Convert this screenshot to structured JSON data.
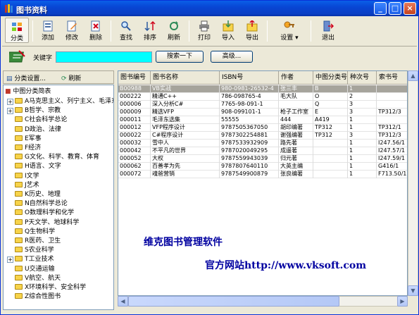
{
  "window": {
    "title": "图书资料"
  },
  "toolbar": {
    "items": [
      {
        "label": "分类",
        "icon": "category-icon"
      },
      {
        "label": "添加",
        "icon": "add-icon"
      },
      {
        "label": "修改",
        "icon": "edit-icon"
      },
      {
        "label": "删除",
        "icon": "delete-icon"
      },
      {
        "label": "查找",
        "icon": "find-icon"
      },
      {
        "label": "排序",
        "icon": "sort-icon"
      },
      {
        "label": "刷新",
        "icon": "refresh-icon"
      },
      {
        "label": "打印",
        "icon": "print-icon"
      },
      {
        "label": "导入",
        "icon": "import-icon"
      },
      {
        "label": "导出",
        "icon": "export-icon"
      },
      {
        "label": "设置",
        "icon": "settings-icon"
      },
      {
        "label": "退出",
        "icon": "exit-icon"
      }
    ]
  },
  "search": {
    "keyword_label": "关键字",
    "keyword_value": "",
    "search_button": "搜索一下",
    "advanced_button": "高级..."
  },
  "left": {
    "category_settings": "分类设置...",
    "refresh": "刷新",
    "root": "中图分类简表",
    "nodes": [
      "A马克思主义、列宁主义、毛泽东",
      "B哲学、宗教",
      "C社会科学总论",
      "D政治、法律",
      "E军事",
      "F经济",
      "G文化、科学、教育、体育",
      "H语言、文字",
      "I文学",
      "J艺术",
      "K历史、地理",
      "N自然科学总论",
      "O数理科学和化学",
      "P天文学、地球科学",
      "Q生物科学",
      "R医药、卫生",
      "S农业科学",
      "T工业技术",
      "U交通运输",
      "V航空、航天",
      "X环境科学、安全科学",
      "Z综合性图书"
    ]
  },
  "grid": {
    "columns": [
      "图书编号",
      "图书名称",
      "ISBN号",
      "作者",
      "中图分类号",
      "种次号",
      "索书号"
    ],
    "rows": [
      [
        "B00988",
        "VB实战",
        "980-0981-26532-4",
        "张三丰",
        "B",
        "1",
        ""
      ],
      [
        "000222",
        "精通C++",
        "786-098765-4",
        "毛大队",
        "O",
        "2",
        ""
      ],
      [
        "000006",
        "深入分析C#",
        "7765-98-091-1",
        "",
        "Q",
        "3",
        ""
      ],
      [
        "000009",
        "精选VFP",
        "908-099101-1",
        "枪子工作室",
        "E",
        "3",
        "TP312/3"
      ],
      [
        "000011",
        "毛泽东选集",
        "55555",
        "444",
        "A419",
        "1",
        ""
      ],
      [
        "000012",
        "VFP程序设计",
        "9787505367050",
        "胡印编著",
        "TP312",
        "1",
        "TP312/1"
      ],
      [
        "000022",
        "C#程序设计",
        "9787302254881",
        "谢强编著",
        "TP312",
        "3",
        "TP312/3"
      ],
      [
        "000032",
        "雪中人",
        "9787533932909",
        "路先著",
        "",
        "1",
        "I247.56/1"
      ],
      [
        "000042",
        "不平凡的世界",
        "9787020049295",
        "成遥著",
        "",
        "1",
        "I247.57/1"
      ],
      [
        "000052",
        "大权",
        "9787559943039",
        "归元著",
        "",
        "1",
        "I247.59/1"
      ],
      [
        "000062",
        "百善孝为先",
        "9787807640110",
        "大英主编",
        "",
        "1",
        "G416/1"
      ],
      [
        "000072",
        "魂爸营销",
        "9787549900879",
        "张良编著",
        "",
        "1",
        "F713.50/1"
      ]
    ]
  },
  "promo": {
    "line1": "维克图书管理软件",
    "line2": "官方网站http://www.vksoft.com"
  }
}
